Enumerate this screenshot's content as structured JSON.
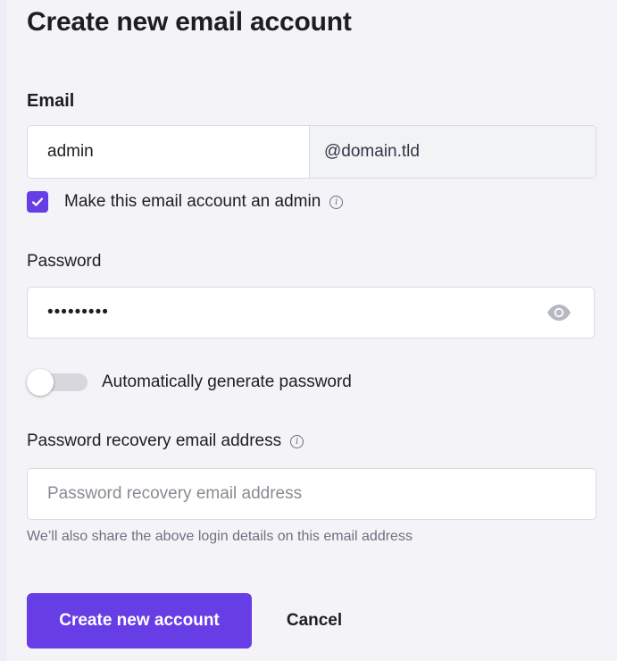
{
  "colors": {
    "accent": "#673de6",
    "text": "#1d1e20",
    "muted": "#6d7081",
    "border": "#dadce0",
    "background": "#f4f4f8"
  },
  "form": {
    "title": "Create new email account",
    "email": {
      "label": "Email",
      "value": "admin",
      "domain": "@domain.tld"
    },
    "admin": {
      "checked": true,
      "label": "Make this email account an admin",
      "info_icon": "info-icon"
    },
    "password": {
      "label": "Password",
      "value": "•••••••••",
      "visibility_icon": "eye-icon"
    },
    "auto_generate": {
      "enabled": false,
      "label": "Automatically generate password"
    },
    "recovery": {
      "label": "Password recovery email address",
      "placeholder": "Password recovery email address",
      "value": "",
      "hint": "We’ll also share the above login details on this email address",
      "info_icon": "info-icon"
    },
    "actions": {
      "submit_label": "Create new account",
      "cancel_label": "Cancel"
    }
  }
}
